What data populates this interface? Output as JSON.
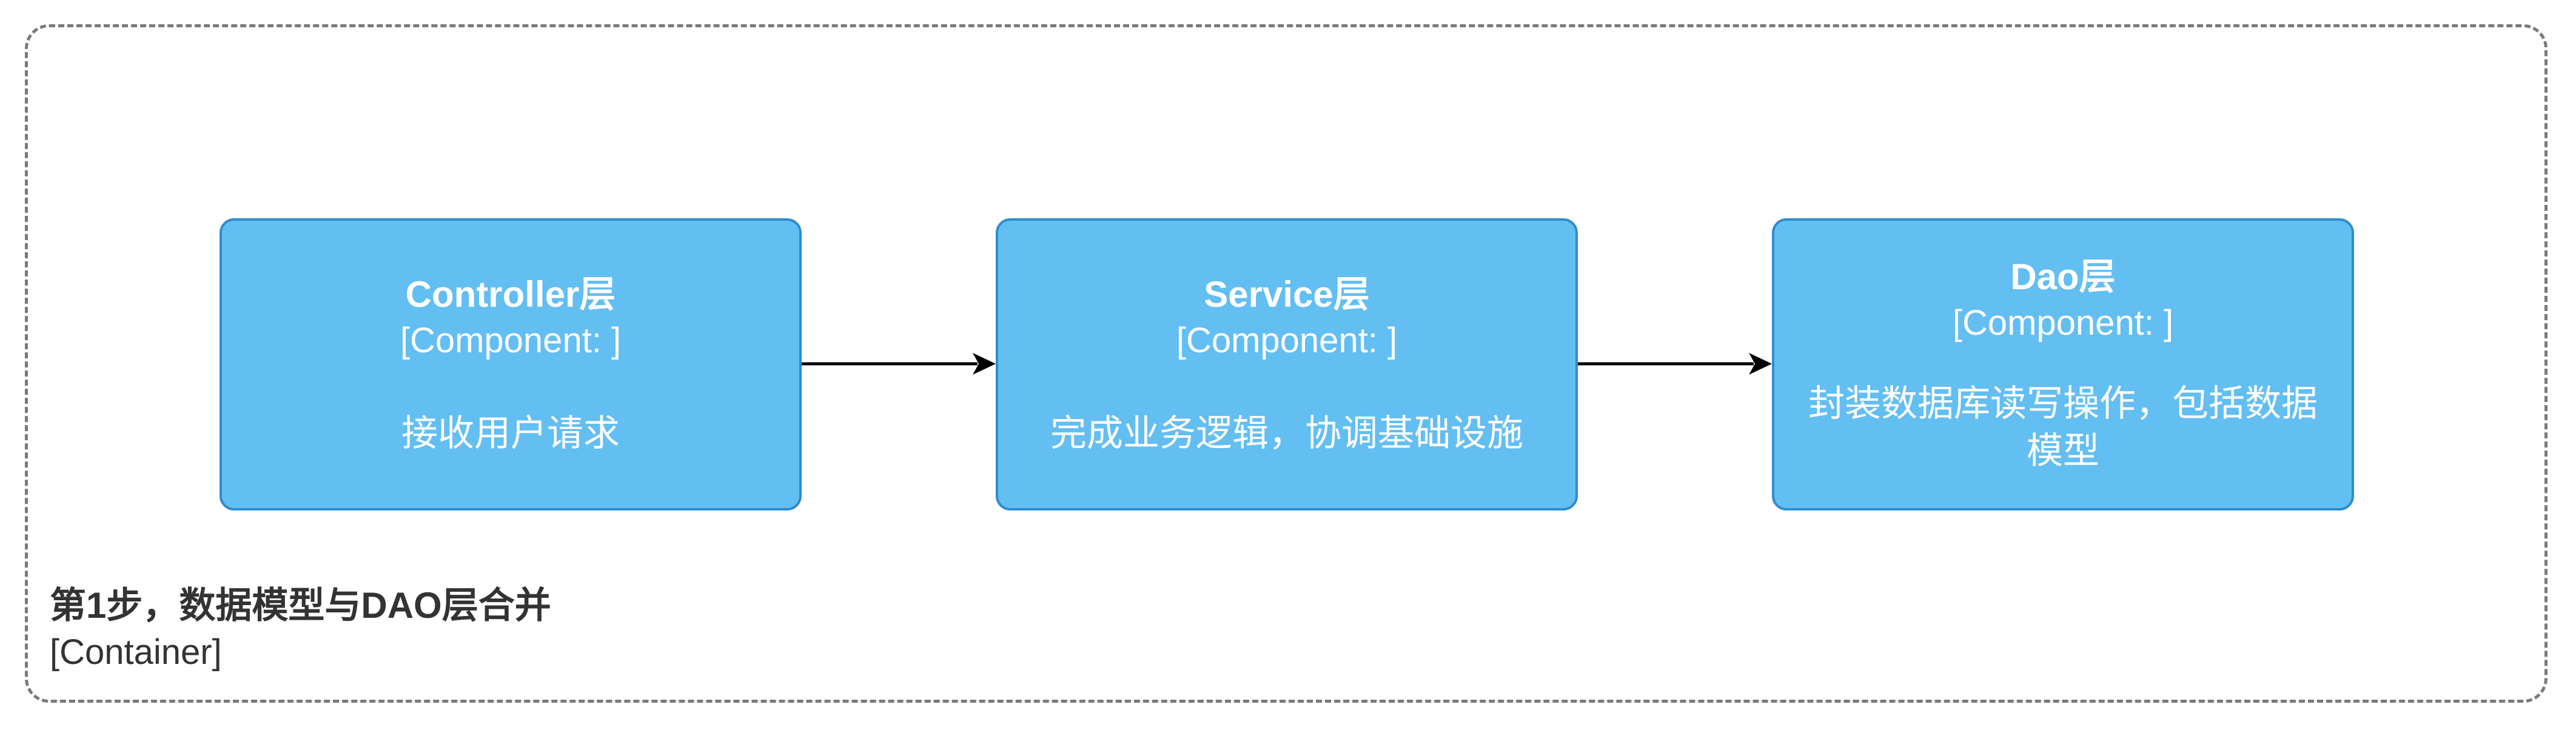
{
  "container": {
    "name": "第1步，数据模型与DAO层合并",
    "type": "[Container]"
  },
  "components": [
    {
      "name": "Controller层",
      "type": "[Component: ]",
      "description": "接收用户请求"
    },
    {
      "name": "Service层",
      "type": "[Component: ]",
      "description": "完成业务逻辑，协调基础设施"
    },
    {
      "name": "Dao层",
      "type": "[Component: ]",
      "description": "封装数据库读写操作，包括数据模型"
    }
  ],
  "relations": [
    {
      "from": "Controller层",
      "to": "Service层"
    },
    {
      "from": "Service层",
      "to": "Dao层"
    }
  ],
  "colors": {
    "component_fill": "#63bef2",
    "component_border": "#2f8ccf",
    "component_text": "#ffffff",
    "boundary_stroke": "#7a7a7a",
    "label_text": "#333333",
    "arrow": "#000000"
  }
}
